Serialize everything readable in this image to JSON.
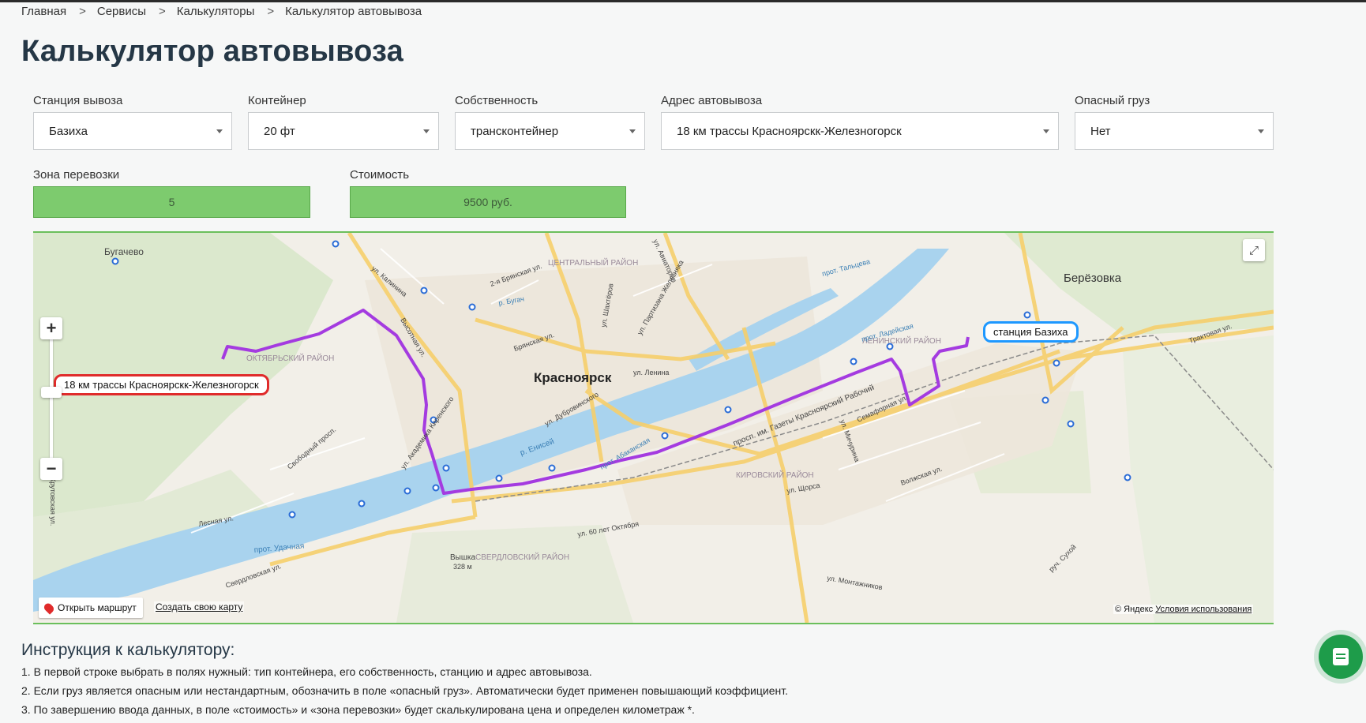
{
  "breadcrumb": {
    "items": [
      "Главная",
      "Сервисы",
      "Калькуляторы",
      "Калькулятор автовывоза"
    ],
    "separator": ">"
  },
  "page_title": "Калькулятор автовывоза",
  "form": {
    "station": {
      "label": "Станция вывоза",
      "value": "Базиха"
    },
    "container": {
      "label": "Контейнер",
      "value": "20 фт"
    },
    "ownership": {
      "label": "Собственность",
      "value": "трансконтейнер"
    },
    "address": {
      "label": "Адрес автовывоза",
      "value": "18 км трассы Красноярскк-Железногорск"
    },
    "dangerous": {
      "label": "Опасный груз",
      "value": "Нет"
    },
    "zone": {
      "label": "Зона перевозки",
      "value": "5"
    },
    "cost": {
      "label": "Стоимость",
      "value": "9500 руб."
    }
  },
  "map": {
    "city_label": "Красноярск",
    "place_labels": [
      "Бугачево",
      "Берёзовка",
      "ЦЕНТРАЛЬНЫЙ РАЙОН",
      "ОКТЯБРЬСКИЙ РАЙОН",
      "ЛЕНИНСКИЙ РАЙОН",
      "КИРОВСКИЙ РАЙОН",
      "СВЕРДЛОВСКИЙ РАЙОН",
      "Вышка",
      "328 м"
    ],
    "street_labels": [
      "ул. Калинина",
      "2-я Брянская ул.",
      "р. Бугач",
      "ул. Шахтёров",
      "ул. Авиаторов",
      "ул. Партизана Железняка",
      "Брянская ул.",
      "ул. Ленина",
      "ул. Дубровинского",
      "р. Енисей",
      "прот. Абаканская",
      "ул. Академика Киренского",
      "Свободный просп.",
      "Лесная ул.",
      "прот. Удачная",
      "Свердловская ул.",
      "ул. 60 лет Октября",
      "прот. Тальцева",
      "прот. Ладейская",
      "просп. им. Газеты Красноярский Рабочий",
      "Семафорная ул.",
      "ул. Мичурина",
      "ул. Щорса",
      "Волжская ул.",
      "ул. Монтажников",
      "руч. Сухой",
      "Трактовая ул.",
      "Крутовская ул.",
      "Высотная ул."
    ],
    "route_start_label": "18 км трассы Красноярскк-Железногорск",
    "route_end_label": "станция Базиха",
    "open_route": "Открыть маршрут",
    "create_map": "Создать свою карту",
    "copyright": "© Яндекс",
    "terms": "Условия использования",
    "route_color": "#a43be0"
  },
  "instructions": {
    "title": "Инструкция к калькулятору:",
    "items": [
      "1. В первой строке выбрать в полях нужный: тип контейнера, его собственность, станцию и адрес автовывоза.",
      "2. Если груз является опасным или нестандартным, обозначить в поле «опасный груз». Автоматически будет применен повышающий коэффициент.",
      "3. По завершению ввода данных, в поле «стоимость» и «зона перевозки» будет скалькулирована цена и определен километраж *."
    ]
  },
  "colors": {
    "accent": "#7dcb6e",
    "heading": "#253746",
    "chat": "#1e9c4a"
  },
  "icons": [
    "zoom-in-icon",
    "zoom-out-icon",
    "fullscreen-icon",
    "map-pin-icon",
    "chat-icon",
    "chevron-down-icon"
  ]
}
